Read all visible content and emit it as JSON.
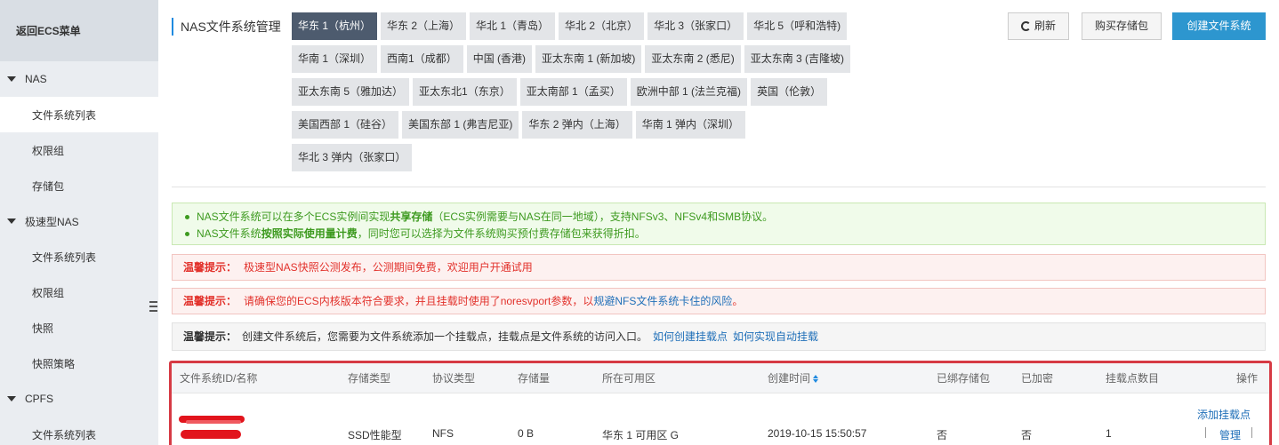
{
  "sidebar": {
    "back_label": "返回ECS菜单",
    "sections": [
      {
        "label": "NAS",
        "items": [
          "文件系统列表",
          "权限组",
          "存储包"
        ]
      },
      {
        "label": "极速型NAS",
        "items": [
          "文件系统列表",
          "权限组",
          "快照",
          "快照策略"
        ]
      },
      {
        "label": "CPFS",
        "items": [
          "文件系统列表"
        ]
      }
    ]
  },
  "header": {
    "title": "NAS文件系统管理",
    "refresh_label": "刷新",
    "buy_label": "购买存储包",
    "create_label": "创建文件系统"
  },
  "regions": [
    "华东 1（杭州）",
    "华东 2（上海）",
    "华北 1（青岛）",
    "华北 2（北京）",
    "华北 3（张家口）",
    "华北 5（呼和浩特)",
    "华南 1（深圳）",
    "西南1（成都）",
    "中国 (香港)",
    "亚太东南 1 (新加坡)",
    "亚太东南 2 (悉尼)",
    "亚太东南 3 (吉隆坡)",
    "亚太东南 5（雅加达）",
    "亚太东北1（东京）",
    "亚太南部 1（孟买）",
    "欧洲中部 1 (法兰克福)",
    "英国（伦敦）",
    "美国西部 1（硅谷）",
    "美国东部 1 (弗吉尼亚)",
    "华东 2 弹内（上海）",
    "华南 1 弹内（深圳）",
    "华北 3 弹内（张家口）"
  ],
  "active_region_index": 0,
  "notices": {
    "green_1_a": "NAS文件系统可以在多个ECS实例间实现",
    "green_1_b": "共享存储",
    "green_1_c": "（ECS实例需要与NAS在同一地域），支持NFSv3、NFSv4和SMB协议。",
    "green_2_a": "NAS文件系统",
    "green_2_b": "按照实际使用量计费",
    "green_2_c": "，同时您可以选择为文件系统购买预付费存储包来获得折扣。",
    "tip_label": "温馨提示：",
    "red_1": "极速型NAS快照公测发布，公测期间免费，欢迎用户开通试用",
    "red_2_a": "请确保您的ECS内核版本符合要求，并且挂载时使用了noresvport参数，以",
    "red_2_link": "规避NFS文件系统卡住的风险",
    "red_2_end": "。",
    "gray_text": "创建文件系统后，您需要为文件系统添加一个挂载点，挂载点是文件系统的访问入口。",
    "gray_link_1": "如何创建挂载点",
    "gray_link_2": "如何实现自动挂载"
  },
  "table": {
    "columns": [
      "文件系统ID/名称",
      "存储类型",
      "协议类型",
      "存储量",
      "所在可用区",
      "创建时间",
      "已绑存储包",
      "已加密",
      "挂载点数目",
      "操作"
    ],
    "row": {
      "storage_type": "SSD性能型",
      "protocol": "NFS",
      "capacity": "0 B",
      "zone": "华东 1 可用区 G",
      "created": "2019-10-15 15:50:57",
      "bound_package": "否",
      "encrypted": "否",
      "mount_count": "1",
      "action_add": "添加挂载点",
      "action_manage": "管理"
    }
  },
  "colors": {
    "primary": "#2d96cf",
    "active_region": "#4d5b6e",
    "highlight_border": "#d63a44",
    "link": "#1f6fb8"
  }
}
